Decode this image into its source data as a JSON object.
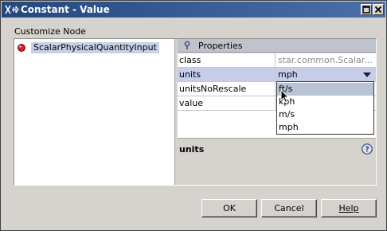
{
  "window": {
    "title": "Constant - Value",
    "icon": "app-logo-icon"
  },
  "tree": {
    "section_label": "Customize Node",
    "items": [
      {
        "label": "ScalarPhysicalQuantityInput",
        "icon": "node-bullet-icon"
      }
    ]
  },
  "properties": {
    "header": "Properties",
    "rows": [
      {
        "name": "class",
        "value": "star.common.Scalar..."
      },
      {
        "name": "units",
        "value": "mph"
      },
      {
        "name": "unitsNoRescale",
        "value": ""
      },
      {
        "name": "value",
        "value": ""
      }
    ],
    "selected_row": "units",
    "dropdown_options": [
      "ft/s",
      "kph",
      "m/s",
      "mph"
    ],
    "dropdown_highlighted": "ft/s",
    "description_title": "units"
  },
  "buttons": {
    "ok": "OK",
    "cancel": "Cancel",
    "help": "Help"
  },
  "colors": {
    "title_bar": "#24487e",
    "selection": "#c6cdeb",
    "dropdown_highlight": "#b8c3d6"
  }
}
